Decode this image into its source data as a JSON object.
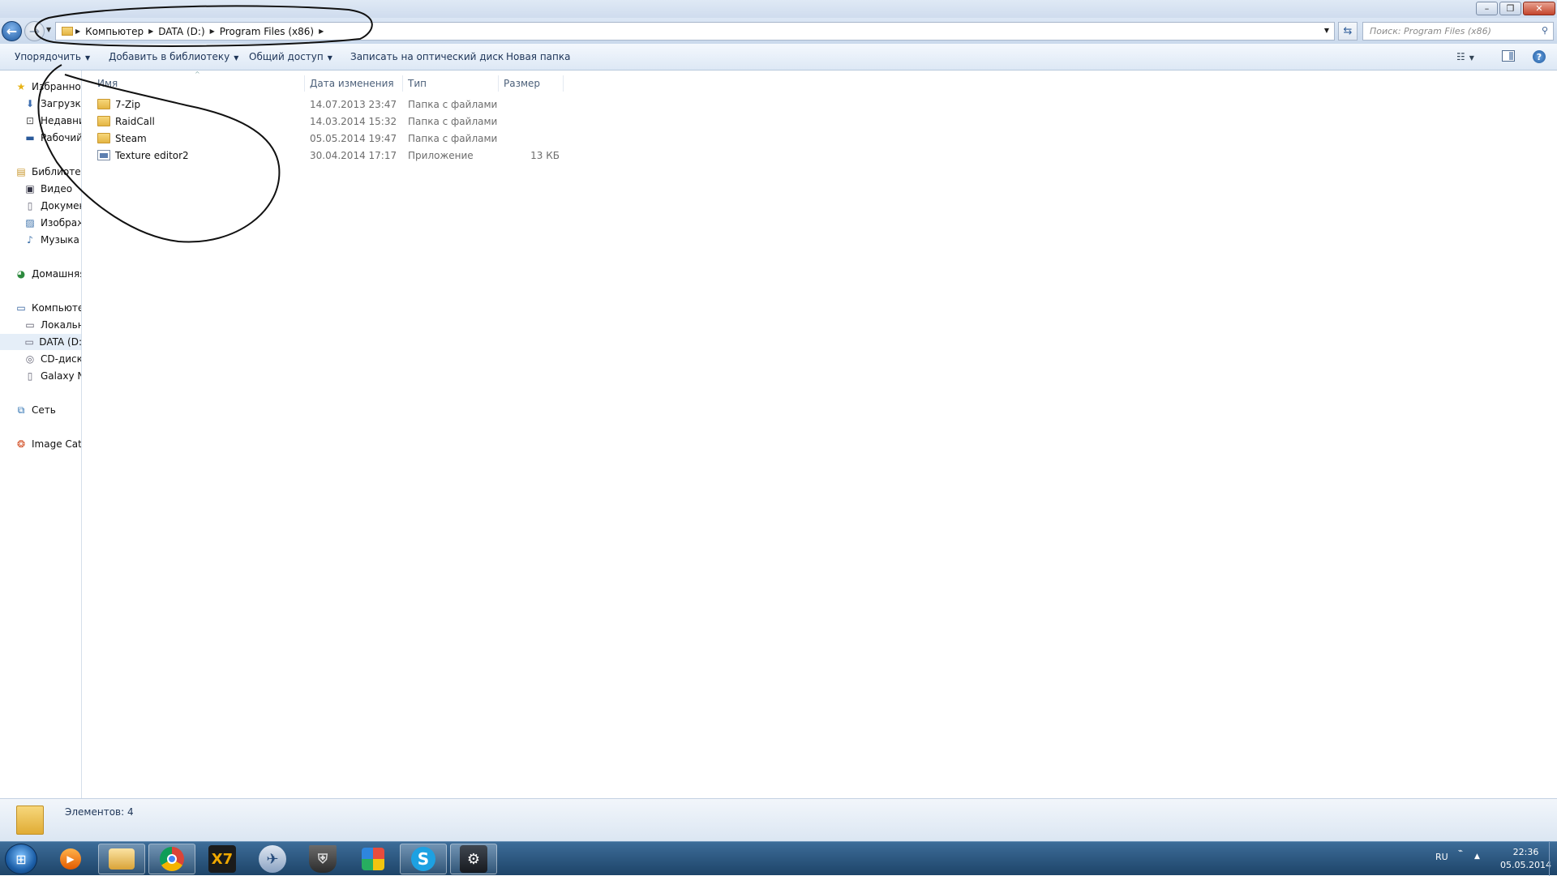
{
  "window": {
    "minimize": "▭",
    "maximize": "▭",
    "close": "✕"
  },
  "address_bar": {
    "crumbs": [
      "Компьютер",
      "DATA (D:)",
      "Program Files (x86)"
    ],
    "search_placeholder": "Поиск: Program Files (x86)"
  },
  "toolbar": {
    "organize": "Упорядочить",
    "add_to_library": "Добавить в библиотеку",
    "share": "Общий доступ",
    "burn": "Записать на оптический диск",
    "new_folder": "Новая папка"
  },
  "nav": {
    "favorites": "Избранное",
    "downloads": "Загрузки",
    "recent": "Недавние",
    "desktop": "Рабочий",
    "libraries": "Библиотеки",
    "video": "Видео",
    "documents": "Документы",
    "images": "Изображения",
    "music": "Музыка",
    "homegroup": "Домашняя",
    "computer": "Компьютер",
    "local_disk": "Локальный",
    "data_drive": "DATA (D:",
    "cd_drive": "CD-дисковод",
    "galaxy": "Galaxy Ne",
    "network": "Сеть",
    "image_catalog": "Image Cata"
  },
  "columns": {
    "name": "Имя",
    "date": "Дата изменения",
    "type": "Тип",
    "size": "Размер"
  },
  "files": [
    {
      "name": "7-Zip",
      "date": "14.07.2013 23:47",
      "type": "Папка с файлами",
      "size": "",
      "kind": "folder"
    },
    {
      "name": "RaidCall",
      "date": "14.03.2014 15:32",
      "type": "Папка с файлами",
      "size": "",
      "kind": "folder"
    },
    {
      "name": "Steam",
      "date": "05.05.2014 19:47",
      "type": "Папка с файлами",
      "size": "",
      "kind": "folder"
    },
    {
      "name": "Texture editor2",
      "date": "30.04.2014 17:17",
      "type": "Приложение",
      "size": "13 КБ",
      "kind": "application"
    }
  ],
  "status": {
    "items": "Элементов: 4"
  },
  "taskbar": {
    "apps": [
      "media-player-icon",
      "explorer-icon",
      "chrome-icon",
      "x7-icon",
      "kerbal-icon",
      "world-of-tanks-icon",
      "control-panel-icon",
      "skype-icon",
      "steam-icon"
    ],
    "x7_label": "X7",
    "skype_label": "S",
    "language": "RU",
    "time": "22:36",
    "date": "05.05.2014"
  },
  "colors": {
    "taskbar": "#1d4468",
    "folder": "#e4b544",
    "toolbar_text": "#1e3558"
  }
}
